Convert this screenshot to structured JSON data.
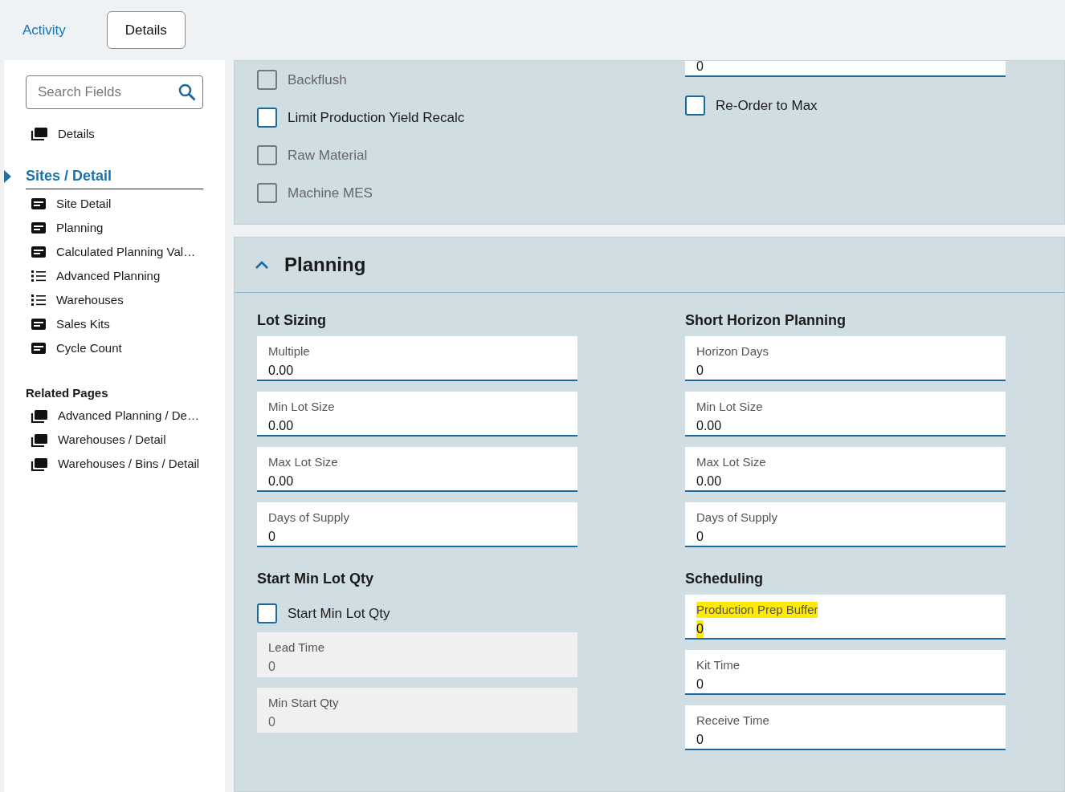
{
  "tabs": [
    {
      "label": "Activity",
      "selected": false
    },
    {
      "label": "Details",
      "selected": true
    }
  ],
  "sidebar": {
    "search": {
      "placeholder": "Search Fields"
    },
    "top_items": [
      {
        "label": "Details",
        "kind": "stack"
      }
    ],
    "section": {
      "label": "Sites / Detail",
      "expanded": true,
      "items": [
        {
          "label": "Site Detail",
          "kind": "card"
        },
        {
          "label": "Planning",
          "kind": "card"
        },
        {
          "label": "Calculated Planning Val…",
          "kind": "card"
        },
        {
          "label": "Advanced Planning",
          "kind": "list"
        },
        {
          "label": "Warehouses",
          "kind": "list"
        },
        {
          "label": "Sales Kits",
          "kind": "card"
        },
        {
          "label": "Cycle Count",
          "kind": "card"
        }
      ]
    },
    "related_title": "Related Pages",
    "related": [
      {
        "label": "Advanced Planning / De…",
        "kind": "stack"
      },
      {
        "label": "Warehouses / Detail",
        "kind": "stack"
      },
      {
        "label": "Warehouses / Bins / Detail",
        "kind": "stack"
      }
    ]
  },
  "top_panel": {
    "left": [
      {
        "kind": "checkbox",
        "label": "Backflush",
        "checked": false,
        "disabled": true
      },
      {
        "kind": "checkbox",
        "label": "Limit Production Yield Recalc",
        "checked": false,
        "disabled": false
      },
      {
        "kind": "checkbox",
        "label": "Raw Material",
        "checked": false,
        "disabled": true
      },
      {
        "kind": "checkbox",
        "label": "Machine MES",
        "checked": false,
        "disabled": true
      }
    ],
    "right": [
      {
        "kind": "cutfield",
        "value": "0"
      },
      {
        "kind": "checkbox",
        "label": "Re-Order to Max",
        "checked": false,
        "disabled": false
      }
    ]
  },
  "planning": {
    "title": "Planning",
    "expanded": true,
    "columns": [
      [
        {
          "title": "Lot Sizing",
          "items": [
            {
              "kind": "field",
              "label": "Multiple",
              "value": "0.00",
              "disabled": false,
              "highlighted": false
            },
            {
              "kind": "field",
              "label": "Min Lot Size",
              "value": "0.00",
              "disabled": false,
              "highlighted": false
            },
            {
              "kind": "field",
              "label": "Max Lot Size",
              "value": "0.00",
              "disabled": false,
              "highlighted": false
            },
            {
              "kind": "field",
              "label": "Days of Supply",
              "value": "0",
              "disabled": false,
              "highlighted": false
            }
          ]
        },
        {
          "title": "Start Min Lot Qty",
          "items": [
            {
              "kind": "checkbox",
              "label": "Start Min Lot Qty",
              "checked": false,
              "disabled": false
            },
            {
              "kind": "field",
              "label": "Lead Time",
              "value": "0",
              "disabled": true,
              "highlighted": false
            },
            {
              "kind": "field",
              "label": "Min Start Qty",
              "value": "0",
              "disabled": true,
              "highlighted": false
            }
          ]
        }
      ],
      [
        {
          "title": "Short Horizon Planning",
          "items": [
            {
              "kind": "field",
              "label": "Horizon Days",
              "value": "0",
              "disabled": false,
              "highlighted": false
            },
            {
              "kind": "field",
              "label": "Min Lot Size",
              "value": "0.00",
              "disabled": false,
              "highlighted": false
            },
            {
              "kind": "field",
              "label": "Max Lot Size",
              "value": "0.00",
              "disabled": false,
              "highlighted": false
            },
            {
              "kind": "field",
              "label": "Days of Supply",
              "value": "0",
              "disabled": false,
              "highlighted": false
            }
          ]
        },
        {
          "title": "Scheduling",
          "items": [
            {
              "kind": "field",
              "label": "Production Prep Buffer",
              "value": "0",
              "disabled": false,
              "highlighted": true
            },
            {
              "kind": "field",
              "label": "Kit Time",
              "value": "0",
              "disabled": false,
              "highlighted": false
            },
            {
              "kind": "field",
              "label": "Receive Time",
              "value": "0",
              "disabled": false,
              "highlighted": false
            }
          ]
        }
      ]
    ]
  }
}
